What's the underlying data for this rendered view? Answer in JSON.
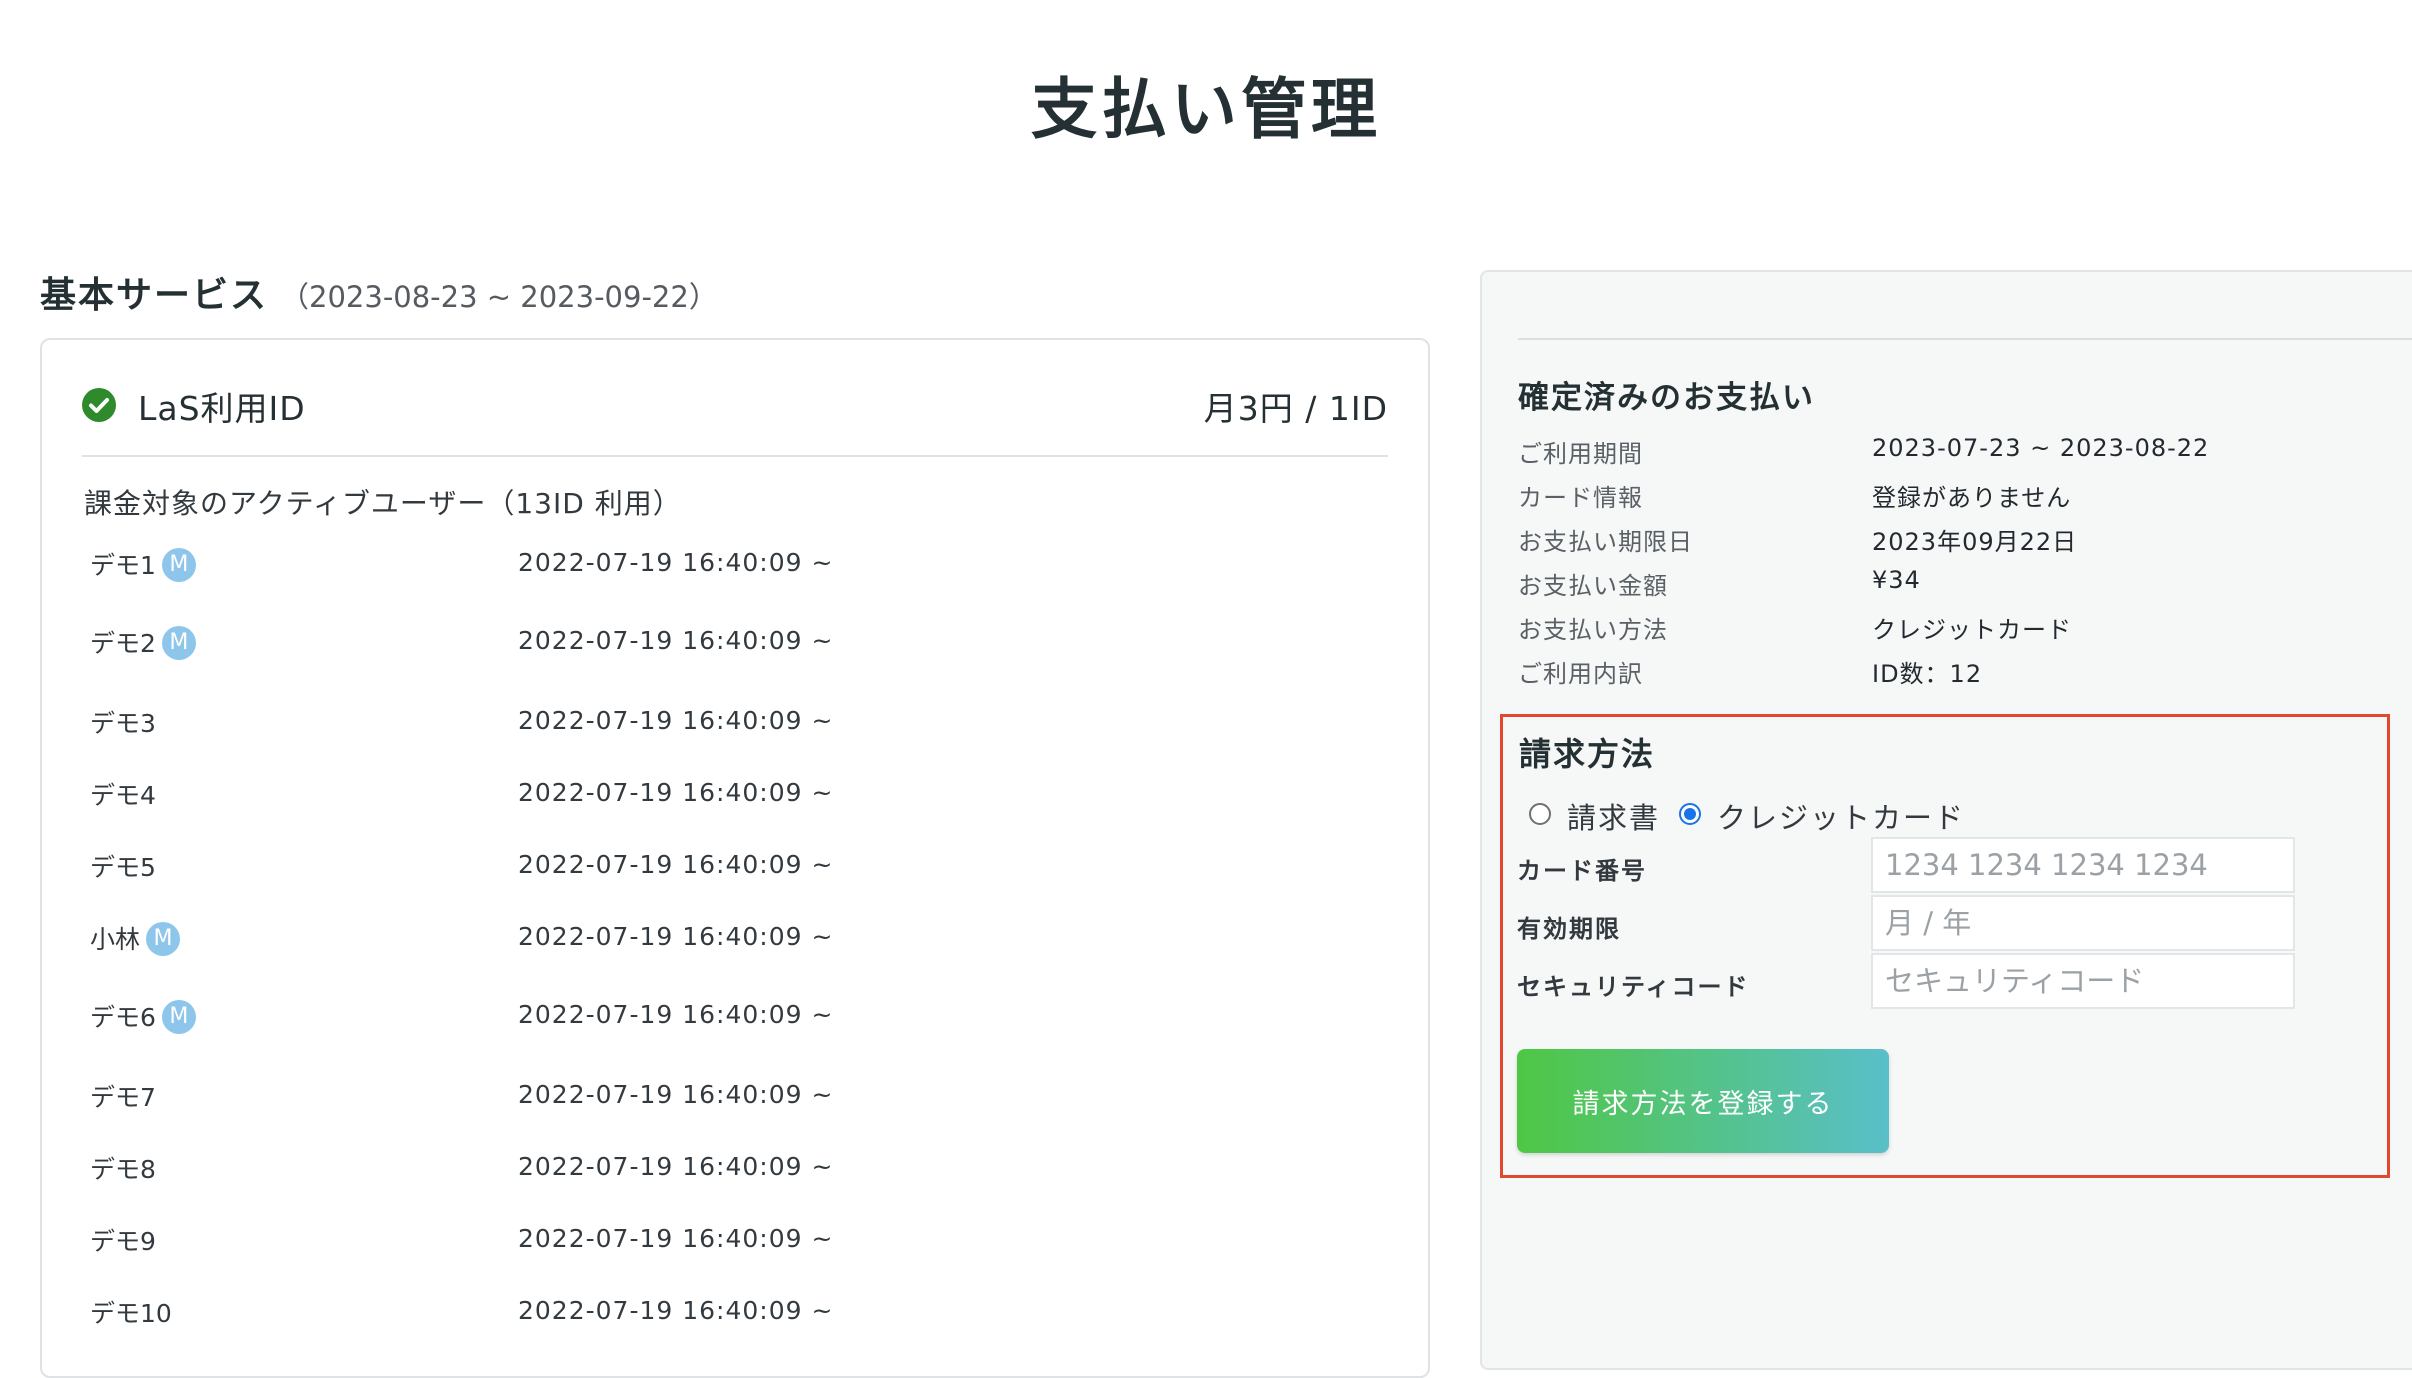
{
  "page": {
    "title": "支払い管理"
  },
  "service": {
    "heading": "基本サービス",
    "period": "（2023-08-23 ~ 2023-09-22）",
    "card": {
      "title": "LaS利用ID",
      "price": "月3円 / 1ID",
      "active_users_heading": "課金対象のアクティブユーザー（13ID 利用）",
      "users": [
        {
          "name": "デモ1",
          "badge": "M",
          "since": "2022-07-19 16:40:09 ~"
        },
        {
          "name": "デモ2",
          "badge": "M",
          "since": "2022-07-19 16:40:09 ~"
        },
        {
          "name": "デモ3",
          "badge": "",
          "since": "2022-07-19 16:40:09 ~"
        },
        {
          "name": "デモ4",
          "badge": "",
          "since": "2022-07-19 16:40:09 ~"
        },
        {
          "name": "デモ5",
          "badge": "",
          "since": "2022-07-19 16:40:09 ~"
        },
        {
          "name": "小林",
          "badge": "M",
          "since": "2022-07-19 16:40:09 ~"
        },
        {
          "name": "デモ6",
          "badge": "M",
          "since": "2022-07-19 16:40:09 ~"
        },
        {
          "name": "デモ7",
          "badge": "",
          "since": "2022-07-19 16:40:09 ~"
        },
        {
          "name": "デモ8",
          "badge": "",
          "since": "2022-07-19 16:40:09 ~"
        },
        {
          "name": "デモ9",
          "badge": "",
          "since": "2022-07-19 16:40:09 ~"
        },
        {
          "name": "デモ10",
          "badge": "",
          "since": "2022-07-19 16:40:09 ~"
        }
      ]
    }
  },
  "confirmed": {
    "title": "確定済みのお支払い",
    "rows": [
      {
        "label": "ご利用期間",
        "value": "2023-07-23 ~ 2023-08-22"
      },
      {
        "label": "カード情報",
        "value": "登録がありません"
      },
      {
        "label": "お支払い期限日",
        "value": "2023年09月22日"
      },
      {
        "label": "お支払い金額",
        "value": "¥34"
      },
      {
        "label": "お支払い方法",
        "value": "クレジットカード"
      },
      {
        "label": "ご利用内訳",
        "value": "ID数：12"
      }
    ]
  },
  "billing": {
    "title": "請求方法",
    "options": [
      {
        "label": "請求書",
        "selected": false
      },
      {
        "label": "クレジットカード",
        "selected": true
      }
    ],
    "fields": [
      {
        "label": "カード番号",
        "placeholder": "1234 1234 1234 1234",
        "value": ""
      },
      {
        "label": "有効期限",
        "placeholder": "月 / 年",
        "value": ""
      },
      {
        "label": "セキュリティコード",
        "placeholder": "セキュリティコード",
        "value": ""
      }
    ],
    "submit_label": "請求方法を登録する"
  },
  "colors": {
    "accent_green": "#2f8a2b",
    "badge_blue": "#8ec5ea",
    "highlight_red": "#e2482d",
    "button_gradient_start": "#4fc744",
    "button_gradient_end": "#59bfc9",
    "radio_blue": "#1a73e8"
  },
  "icons": {
    "status": "check-circle-icon",
    "user_badge": "m-badge-icon"
  }
}
